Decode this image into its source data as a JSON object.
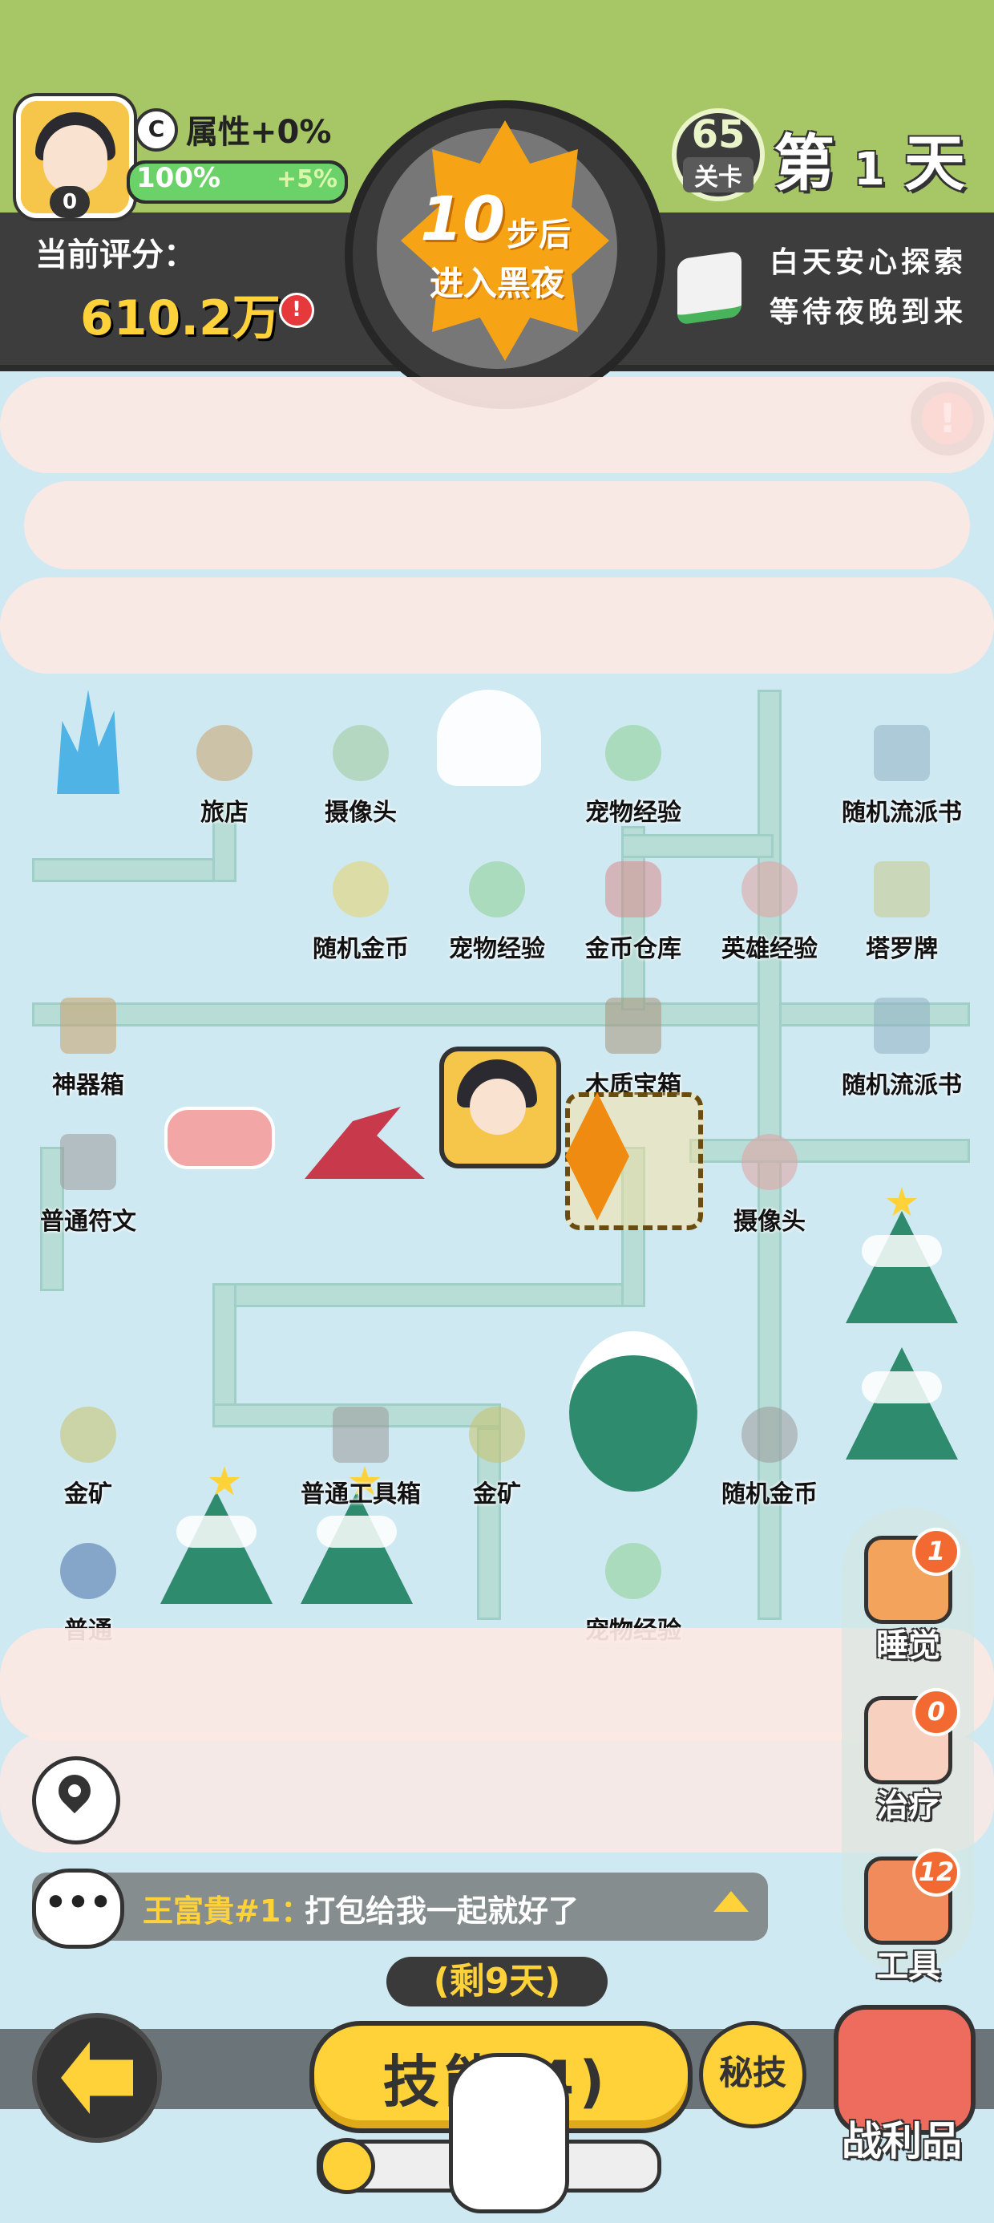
{
  "header": {
    "player": {
      "level": "0"
    },
    "attribute": {
      "icon": "attribute-c-icon",
      "icon_glyph": "C",
      "label": "属性+0%"
    },
    "exp": {
      "percent_label": "100%",
      "bonus_label": "+5%",
      "fill_fraction": 1.0
    },
    "score": {
      "label": "当前评分：",
      "value": "610.2万",
      "info_glyph": "!"
    },
    "timer": {
      "steps": "10",
      "steps_unit": "步后",
      "subtitle": "进入黑夜"
    },
    "stage": {
      "number": "65",
      "label": "关卡"
    },
    "day": {
      "prefix": "第",
      "number": "1",
      "suffix": "天"
    },
    "tip": {
      "line1": "白天安心探索",
      "line2": "等待夜晚到来"
    },
    "alert_glyph": "!"
  },
  "map": {
    "cells": [
      {
        "id": "r0c1",
        "label": "旅店"
      },
      {
        "id": "r0c2",
        "label": "摄像头"
      },
      {
        "id": "r0c4",
        "label": "宠物经验"
      },
      {
        "id": "r0c6",
        "label": "随机流派书"
      },
      {
        "id": "r1c2",
        "label": "随机金币"
      },
      {
        "id": "r1c3",
        "label": "宠物经验"
      },
      {
        "id": "r1c4",
        "label": "金币仓库"
      },
      {
        "id": "r1c5",
        "label": "英雄经验"
      },
      {
        "id": "r1c6",
        "label": "塔罗牌"
      },
      {
        "id": "r2c0",
        "label": "神器箱"
      },
      {
        "id": "r2c4",
        "label": "木质宝箱"
      },
      {
        "id": "r2c6",
        "label": "随机流派书"
      },
      {
        "id": "r3c0",
        "label": "普通符文"
      },
      {
        "id": "r3c5",
        "label": "摄像头"
      },
      {
        "id": "r5c0",
        "label": "金矿"
      },
      {
        "id": "r5c2",
        "label": "普通工具箱"
      },
      {
        "id": "r5c3",
        "label": "金矿"
      },
      {
        "id": "r5c5",
        "label": "随机金币"
      },
      {
        "id": "r6c0",
        "label": "普通"
      },
      {
        "id": "r6c4",
        "label": "宠物经验"
      }
    ]
  },
  "side_actions": [
    {
      "name": "sleep",
      "label": "睡觉",
      "badge": "1"
    },
    {
      "name": "heal",
      "label": "治疗",
      "badge": "0"
    },
    {
      "name": "tools",
      "label": "工具",
      "badge": "12"
    }
  ],
  "chat": {
    "icon_glyph": "•••",
    "sender": "王富貴#1：",
    "message": "打包给我一起就好了"
  },
  "bottom": {
    "days_left": "(剩9天)",
    "skill_label": "技能(4)",
    "secret_label": "秘技",
    "loot_label": "战利品"
  },
  "colors": {
    "header_green": "#a7c767",
    "header_dark": "#3d3d3d",
    "accent_yellow": "#ffd23a",
    "timer_orange": "#f6a316",
    "exp_green": "#6bd26a"
  }
}
